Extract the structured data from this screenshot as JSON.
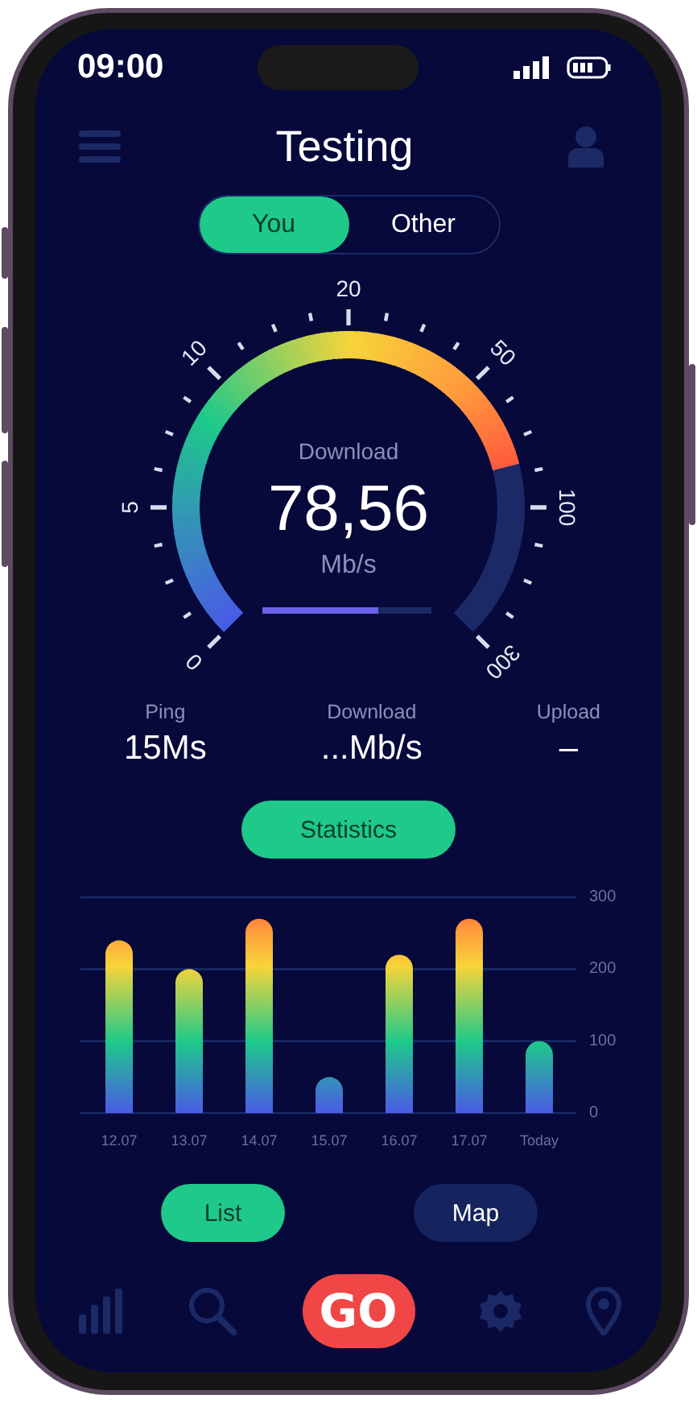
{
  "status_bar": {
    "time": "09:00"
  },
  "header": {
    "title": "Testing"
  },
  "segments": [
    {
      "label": "You",
      "selected": true
    },
    {
      "label": "Other",
      "selected": false
    }
  ],
  "gauge": {
    "label": "Download",
    "value": "78,56",
    "unit": "Mb/s",
    "scale": [
      "0",
      "5",
      "10",
      "20",
      "50",
      "100",
      "300"
    ],
    "progress": {
      "level": 0.69
    }
  },
  "stats": [
    {
      "label": "Ping",
      "value": "15Ms"
    },
    {
      "label": "Download",
      "value": "...Mb/s"
    },
    {
      "label": "Upload",
      "value": "–"
    }
  ],
  "statistics_button": "Statistics",
  "chart_data": {
    "type": "bar",
    "categories": [
      "12.07",
      "13.07",
      "14.07",
      "15.07",
      "16.07",
      "17.07",
      "Today"
    ],
    "values": [
      240,
      200,
      270,
      50,
      220,
      270,
      100
    ],
    "ylim": [
      0,
      300
    ],
    "yticks": [
      0,
      100,
      200,
      300
    ]
  },
  "view_toggle": [
    {
      "label": "List",
      "selected": true
    },
    {
      "label": "Map",
      "selected": false
    }
  ],
  "nav": [
    {
      "kind": "chart"
    },
    {
      "kind": "search"
    },
    {
      "kind": "go",
      "label": "GO"
    },
    {
      "kind": "settings"
    },
    {
      "kind": "pin"
    }
  ]
}
